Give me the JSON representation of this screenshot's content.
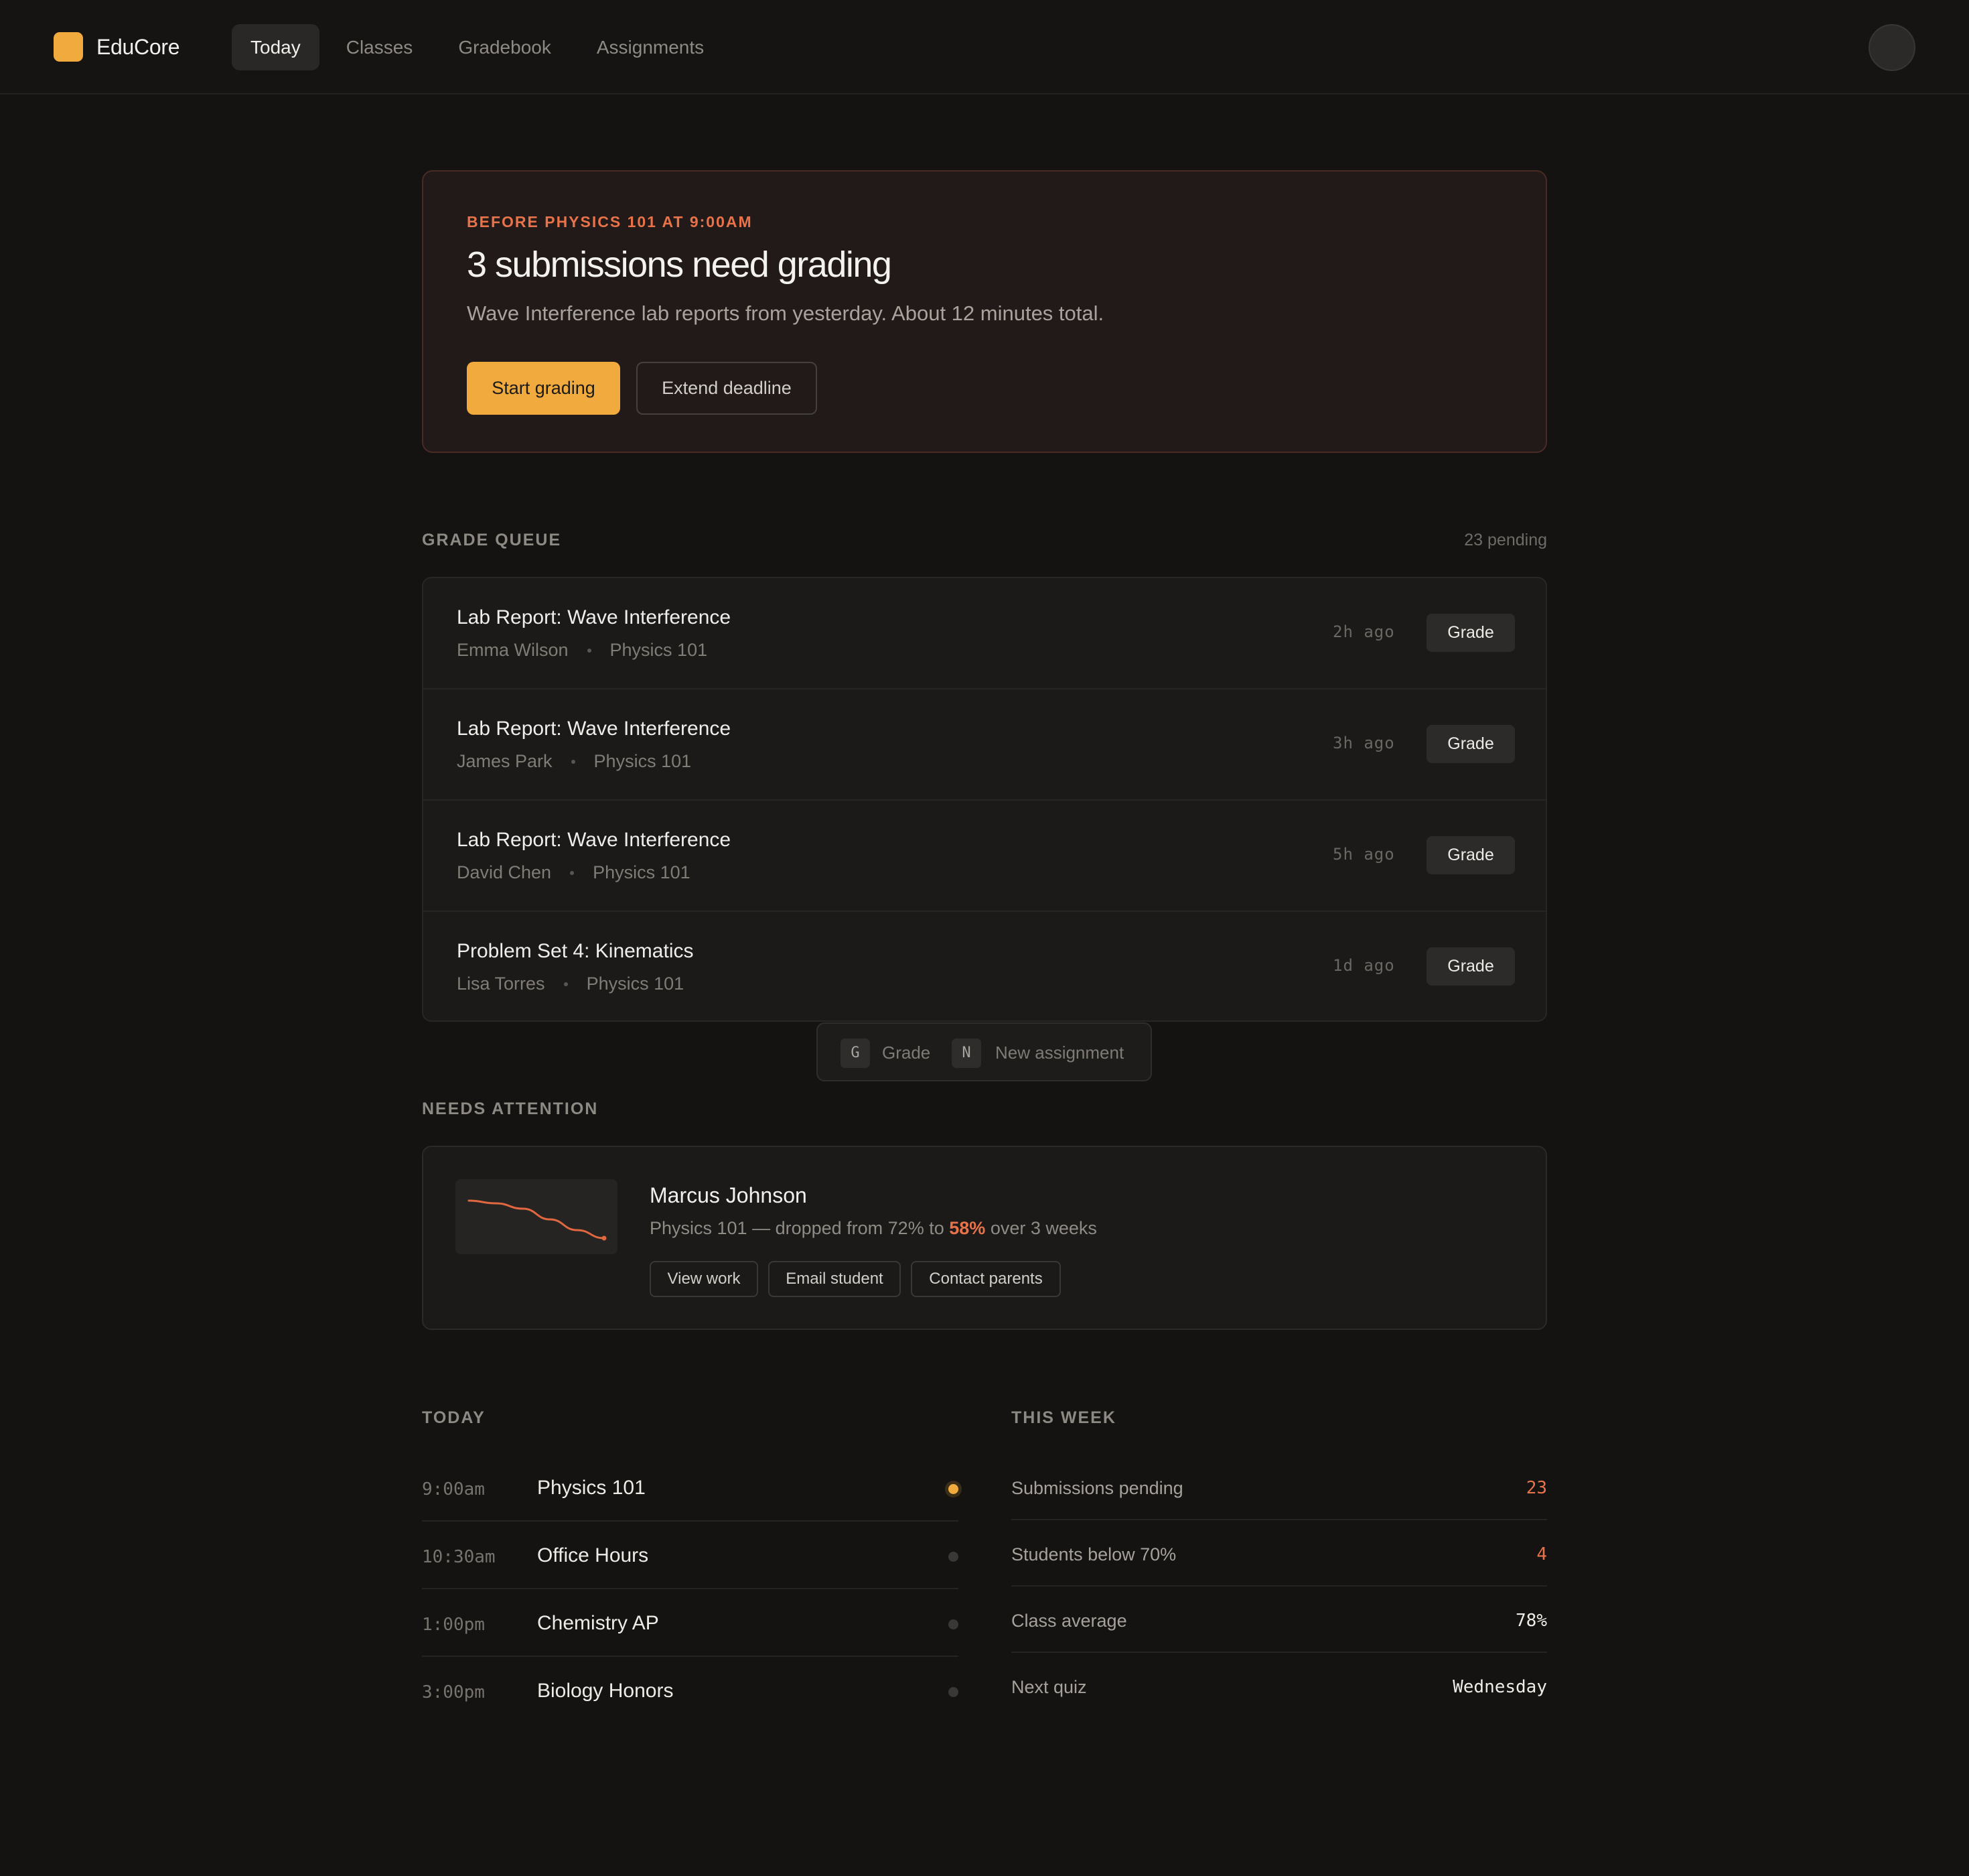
{
  "app": {
    "name": "EduCore",
    "accent": "#f0aa3d",
    "alert_color": "#e8734a"
  },
  "nav": {
    "tabs": [
      {
        "label": "Today",
        "active": true
      },
      {
        "label": "Classes",
        "active": false
      },
      {
        "label": "Gradebook",
        "active": false
      },
      {
        "label": "Assignments",
        "active": false
      }
    ]
  },
  "hero": {
    "eyebrow": "BEFORE PHYSICS 101 AT 9:00AM",
    "title": "3 submissions need grading",
    "subtitle": "Wave Interference lab reports from yesterday. About 12 minutes total.",
    "primary_button": "Start grading",
    "secondary_button": "Extend deadline"
  },
  "grade_queue": {
    "label": "GRADE QUEUE",
    "count_text": "23 pending",
    "items": [
      {
        "title": "Lab Report: Wave Interference",
        "student": "Emma Wilson",
        "class": "Physics 101",
        "time": "2h ago",
        "button": "Grade"
      },
      {
        "title": "Lab Report: Wave Interference",
        "student": "James Park",
        "class": "Physics 101",
        "time": "3h ago",
        "button": "Grade"
      },
      {
        "title": "Lab Report: Wave Interference",
        "student": "David Chen",
        "class": "Physics 101",
        "time": "5h ago",
        "button": "Grade"
      },
      {
        "title": "Problem Set 4: Kinematics",
        "student": "Lisa Torres",
        "class": "Physics 101",
        "time": "1d ago",
        "button": "Grade"
      }
    ]
  },
  "shortcuts": {
    "items": [
      {
        "key": "G",
        "label": "Grade"
      },
      {
        "key": "N",
        "label": "New assignment"
      }
    ]
  },
  "needs_attention": {
    "label": "NEEDS ATTENTION",
    "student": {
      "name": "Marcus Johnson",
      "desc_prefix": "Physics 101 — dropped from 72% to",
      "desc_highlight": "58%",
      "desc_suffix": "over 3 weeks",
      "trend": [
        72,
        71,
        69,
        65,
        61,
        58
      ]
    },
    "actions": [
      "View work",
      "Email student",
      "Contact parents"
    ]
  },
  "today": {
    "label": "TODAY",
    "items": [
      {
        "time": "9:00am",
        "title": "Physics 101",
        "live": true
      },
      {
        "time": "10:30am",
        "title": "Office Hours",
        "live": false
      },
      {
        "time": "1:00pm",
        "title": "Chemistry AP",
        "live": false
      },
      {
        "time": "3:00pm",
        "title": "Biology Honors",
        "live": false
      }
    ]
  },
  "this_week": {
    "label": "THIS WEEK",
    "items": [
      {
        "label": "Submissions pending",
        "value": "23",
        "warn": true
      },
      {
        "label": "Students below 70%",
        "value": "4",
        "warn": true
      },
      {
        "label": "Class average",
        "value": "78%",
        "warn": false
      },
      {
        "label": "Next quiz",
        "value": "Wednesday",
        "warn": false
      }
    ]
  }
}
